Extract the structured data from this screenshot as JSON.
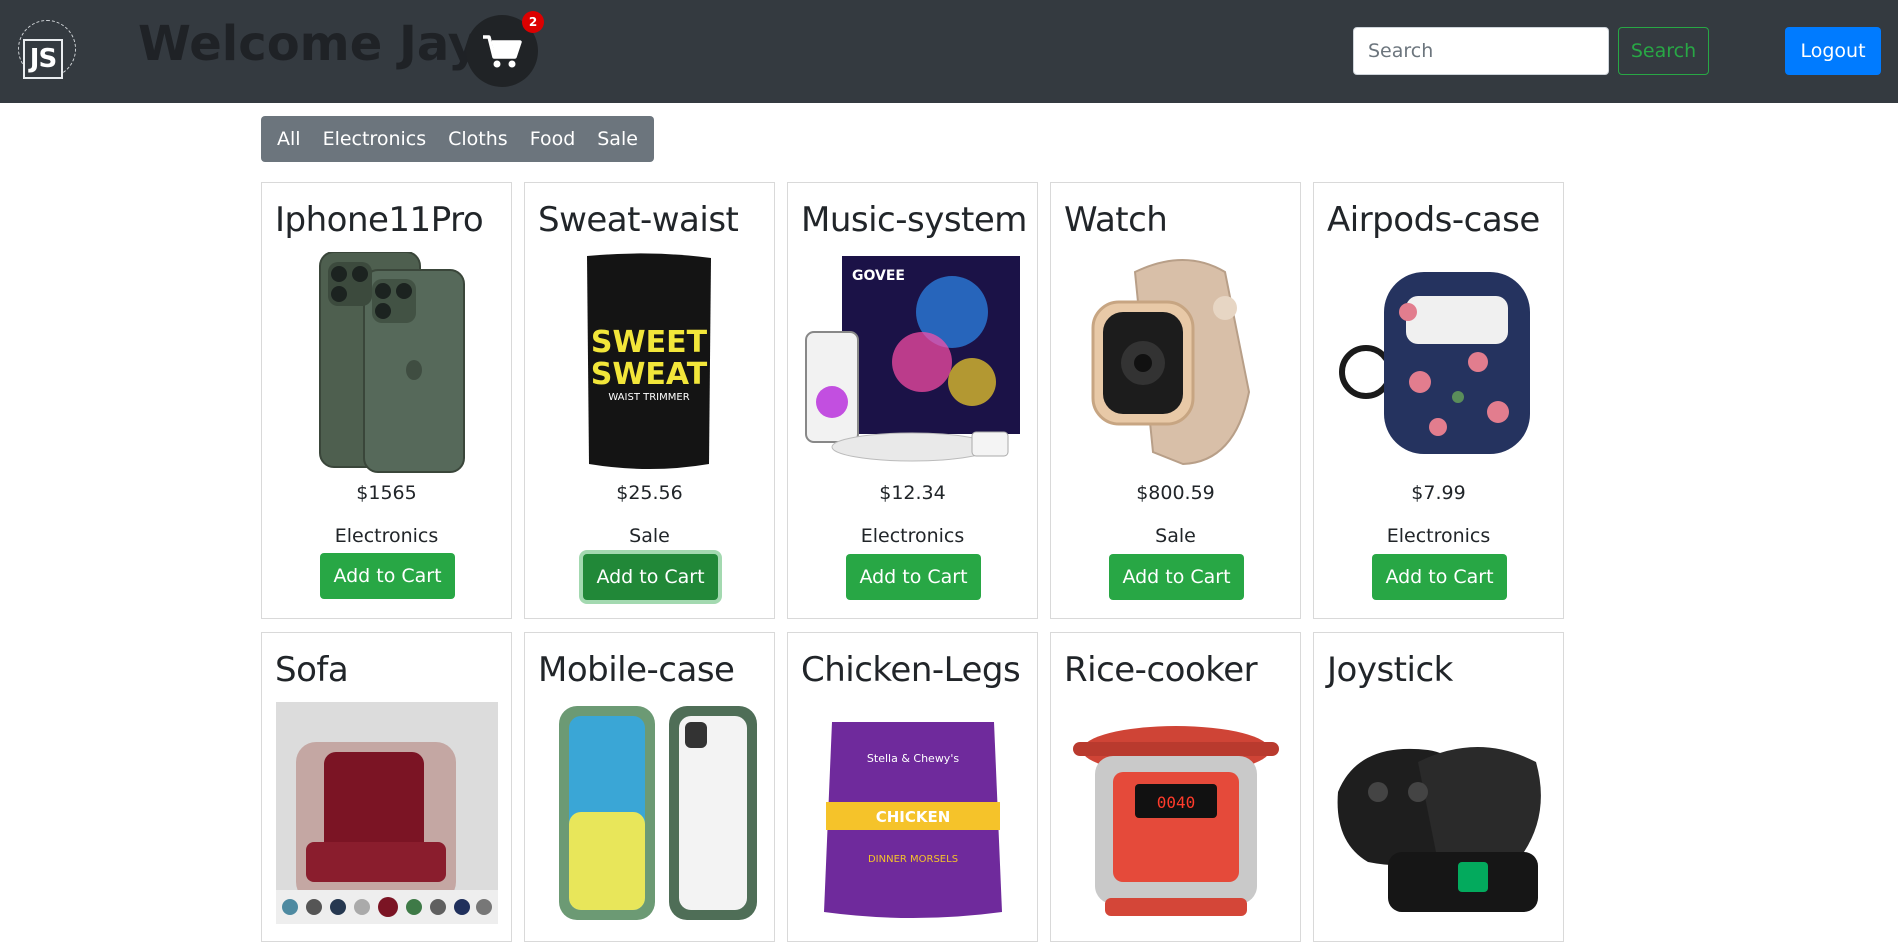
{
  "header": {
    "logo_text": "JS",
    "welcome": "Welcome Jay",
    "cart_count": "2",
    "search_placeholder": "Search",
    "search_button": "Search",
    "logout_button": "Logout"
  },
  "filters": [
    "All",
    "Electronics",
    "Cloths",
    "Food",
    "Sale"
  ],
  "products": [
    {
      "name": "Iphone11Pro",
      "price": "$1565",
      "category": "Electronics",
      "button": "Add to Cart"
    },
    {
      "name": "Sweat-waist",
      "price": "$25.56",
      "category": "Sale",
      "button": "Add to Cart"
    },
    {
      "name": "Music-system",
      "price": "$12.34",
      "category": "Electronics",
      "button": "Add to Cart"
    },
    {
      "name": "Watch",
      "price": "$800.59",
      "category": "Sale",
      "button": "Add to Cart"
    },
    {
      "name": "Airpods-case",
      "price": "$7.99",
      "category": "Electronics",
      "button": "Add to Cart"
    },
    {
      "name": "Sofa"
    },
    {
      "name": "Mobile-case"
    },
    {
      "name": "Chicken-Legs"
    },
    {
      "name": "Rice-cooker"
    },
    {
      "name": "Joystick"
    }
  ],
  "product_images": {
    "sweat_text_1": "SWEET",
    "sweat_text_2": "SWEAT",
    "sweat_text_3": "WAIST TRIMMER",
    "music_brand": "GOVEE",
    "food_brand": "Stella & Chewy's",
    "food_flavor": "CHICKEN",
    "food_label": "DINNER MORSELS",
    "cooker_display": "0040"
  }
}
